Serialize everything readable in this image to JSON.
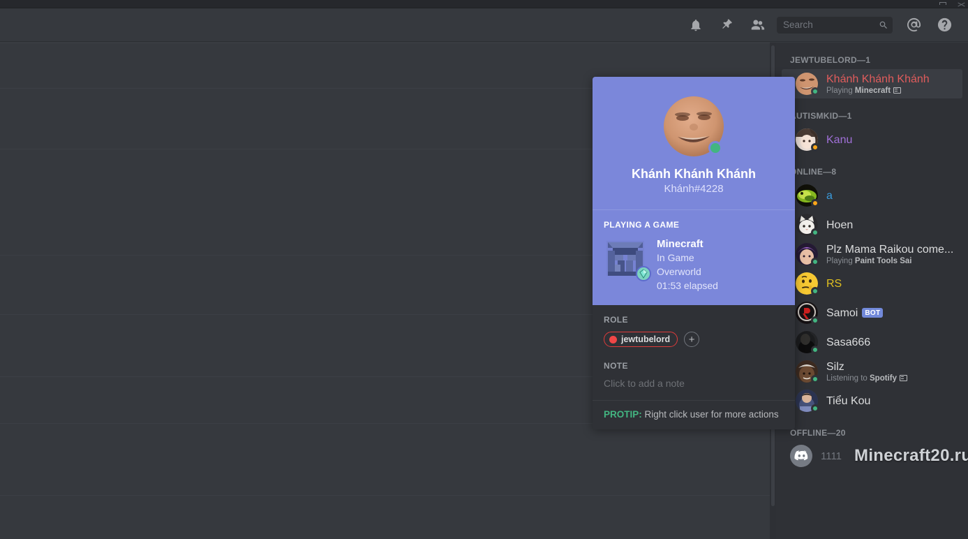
{
  "window": {
    "maximize_icon": "maximize-icon",
    "close_icon": "close-icon"
  },
  "toolbar": {
    "icons": [
      {
        "name": "notifications-bell-icon",
        "label": "Notifications"
      },
      {
        "name": "pinned-messages-icon",
        "label": "Pinned Messages"
      },
      {
        "name": "member-list-icon",
        "label": "Member List"
      }
    ],
    "search": {
      "placeholder": "Search",
      "value": "",
      "icon": "search-icon"
    },
    "mentions": {
      "name": "mentions-icon",
      "label": "Mentions"
    },
    "help": {
      "name": "help-icon",
      "label": "Help"
    }
  },
  "user_card": {
    "avatar": "khanh-avatar",
    "status": "online",
    "status_color": "#43b581",
    "header_color": "#7b87da",
    "username": "Khánh Khánh Khánh",
    "discriminator": "Khánh#4228",
    "activity": {
      "header": "PLAYING A GAME",
      "icon": "minecraft-icon",
      "small_icon": "minecraft-diamond-icon",
      "name": "Minecraft",
      "state": "In Game",
      "details": "Overworld",
      "elapsed": "01:53 elapsed"
    },
    "role_section": {
      "header": "ROLE",
      "roles": [
        {
          "name": "jewtubelord",
          "color": "#f04747"
        }
      ],
      "add_label": "+"
    },
    "note_section": {
      "header": "NOTE",
      "placeholder": "Click to add a note"
    },
    "footer": {
      "prefix": "PROTIP:",
      "text": " Right click user for more actions",
      "accent": "#43b581"
    }
  },
  "member_list": {
    "groups": [
      {
        "header": "JEWTUBELORD—1",
        "members": [
          {
            "name": "Khánh Khánh Khánh",
            "name_color": "#e05c5c",
            "status": "online",
            "activity_prefix": "Playing ",
            "activity_name": "Minecraft",
            "has_activity_icon": true,
            "active": true,
            "avatar_kind": "photo-face"
          }
        ]
      },
      {
        "header": "AUTISMKID—1",
        "members": [
          {
            "name": "Kanu",
            "name_color": "#a070d8",
            "status": "idle",
            "activity_prefix": "",
            "activity_name": "",
            "has_activity_icon": false,
            "active": false,
            "avatar_kind": "photo-anime"
          }
        ]
      },
      {
        "header": "ONLINE—8",
        "members": [
          {
            "name": "a",
            "name_color": "#3a9bdc",
            "status": "idle",
            "activity_prefix": "",
            "activity_name": "",
            "has_activity_icon": false,
            "active": false,
            "avatar_kind": "photo-green"
          },
          {
            "name": "Hoen",
            "name_color": "#dcddde",
            "status": "online",
            "activity_prefix": "",
            "activity_name": "",
            "has_activity_icon": false,
            "active": false,
            "avatar_kind": "photo-white-cat"
          },
          {
            "name": "Plz Mama Raikou come...",
            "name_color": "#dcddde",
            "status": "online",
            "activity_prefix": "Playing ",
            "activity_name": "Paint Tools Sai",
            "has_activity_icon": false,
            "active": false,
            "avatar_kind": "photo-purple"
          },
          {
            "name": "RS",
            "name_color": "#e0c020",
            "status": "online",
            "activity_prefix": "",
            "activity_name": "",
            "has_activity_icon": false,
            "active": false,
            "avatar_kind": "emoji-thinking"
          },
          {
            "name": "Samoi",
            "name_color": "#dcddde",
            "status": "online",
            "bot": "BOT",
            "activity_prefix": "",
            "activity_name": "",
            "has_activity_icon": false,
            "active": false,
            "avatar_kind": "photo-red-r"
          },
          {
            "name": "Sasa666",
            "name_color": "#dcddde",
            "status": "online",
            "activity_prefix": "",
            "activity_name": "",
            "has_activity_icon": false,
            "active": false,
            "avatar_kind": "photo-dark"
          },
          {
            "name": "Silz",
            "name_color": "#dcddde",
            "status": "online",
            "activity_prefix": "Listening to ",
            "activity_name": "Spotify",
            "has_activity_icon": true,
            "active": false,
            "avatar_kind": "photo-brown"
          },
          {
            "name": "Tiểu Kou",
            "name_color": "#dcddde",
            "status": "online",
            "activity_prefix": "",
            "activity_name": "",
            "has_activity_icon": false,
            "active": false,
            "avatar_kind": "photo-blue"
          }
        ]
      },
      {
        "header": "OFFLINE—20",
        "members": []
      }
    ],
    "offline_entry": {
      "name": "1111",
      "avatar_kind": "discord-logo"
    }
  },
  "watermark": {
    "text": "Minecraft20.ru"
  }
}
